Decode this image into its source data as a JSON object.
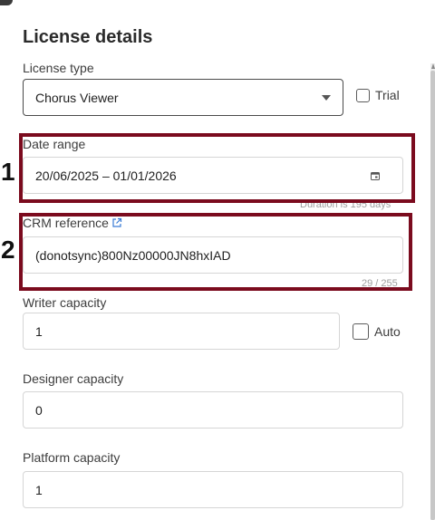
{
  "panel": {
    "title": "License details"
  },
  "license_type": {
    "label": "License type",
    "value": "Chorus Viewer",
    "trial_label": "Trial"
  },
  "date_range": {
    "label": "Date range",
    "value": "20/06/2025 – 01/01/2026",
    "hint": "Duration is 195 days"
  },
  "crm_reference": {
    "label": "CRM reference",
    "value": "(donotsync)800Nz00000JN8hxIAD",
    "counter": "29 / 255"
  },
  "writer_capacity": {
    "label": "Writer capacity",
    "value": "1",
    "auto_label": "Auto"
  },
  "designer_capacity": {
    "label": "Designer capacity",
    "value": "0"
  },
  "platform_capacity": {
    "label": "Platform capacity",
    "value": "1"
  },
  "annotations": {
    "marker_1": "1",
    "marker_2": "2",
    "color": "#7b0b1e"
  }
}
